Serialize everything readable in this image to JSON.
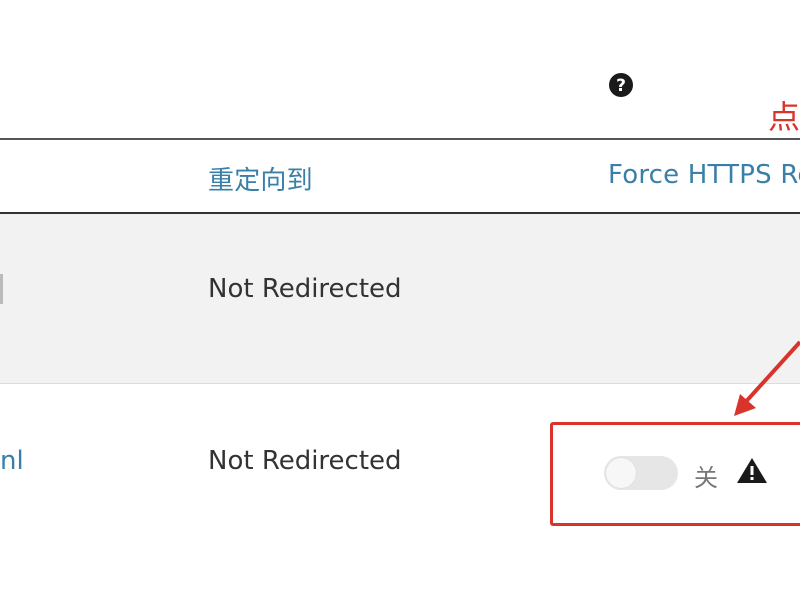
{
  "table": {
    "headers": {
      "redirects_to": "重定向到",
      "force_https": "Force HTTPS Re"
    },
    "rows": [
      {
        "domain": "",
        "redirects_to": "Not Redirected"
      },
      {
        "domain": "nl",
        "redirects_to": "Not Redirected",
        "toggle_state": "关"
      }
    ]
  },
  "annotation": {
    "text": "点",
    "color": "#d9342b"
  },
  "colors": {
    "link": "#3a7fa8",
    "highlight": "#d9342b",
    "row_alt": "#f2f2f2"
  },
  "icons": {
    "help": "question-circle-icon",
    "warning": "warning-triangle-icon"
  }
}
